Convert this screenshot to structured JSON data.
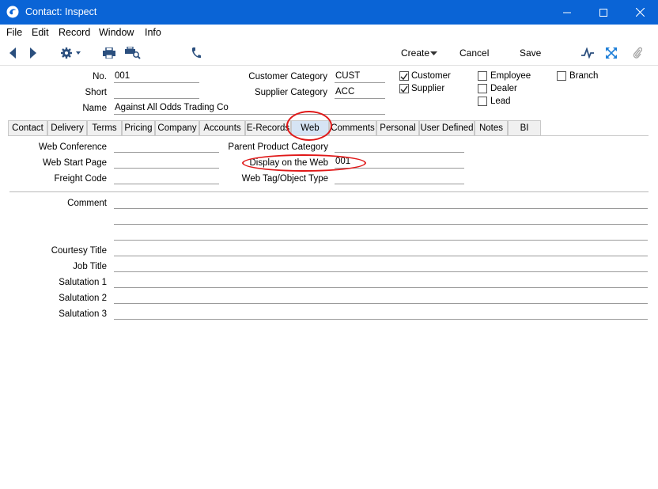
{
  "window": {
    "title": "Contact: Inspect"
  },
  "menu": [
    "File",
    "Edit",
    "Record",
    "Window",
    "Info"
  ],
  "toolbar": {
    "create_label": "Create",
    "cancel_label": "Cancel",
    "save_label": "Save"
  },
  "header": {
    "no_label": "No.",
    "no_value": "001",
    "short_label": "Short",
    "short_value": "",
    "name_label": "Name",
    "name_value": "Against All Odds Trading Co",
    "cust_cat_label": "Customer Category",
    "cust_cat_value": "CUST",
    "supp_cat_label": "Supplier Category",
    "supp_cat_value": "ACC",
    "checkboxes": {
      "customer": {
        "label": "Customer",
        "checked": true
      },
      "supplier": {
        "label": "Supplier",
        "checked": true
      },
      "employee": {
        "label": "Employee",
        "checked": false
      },
      "dealer": {
        "label": "Dealer",
        "checked": false
      },
      "lead": {
        "label": "Lead",
        "checked": false
      },
      "branch": {
        "label": "Branch",
        "checked": false
      }
    }
  },
  "tabs": [
    "Contact",
    "Delivery",
    "Terms",
    "Pricing",
    "Company",
    "Accounts",
    "E-Records",
    "Web",
    "Comments",
    "Personal",
    "User Defined",
    "Notes",
    "BI"
  ],
  "active_tab": "Web",
  "web": {
    "web_conference_label": "Web Conference",
    "web_conference_value": "",
    "web_start_page_label": "Web Start Page",
    "web_start_page_value": "",
    "freight_code_label": "Freight Code",
    "freight_code_value": "",
    "parent_product_category_label": "Parent Product Category",
    "parent_product_category_value": "",
    "display_on_web_label": "Display on the Web",
    "display_on_web_value": "001",
    "web_tag_label": "Web Tag/Object Type",
    "web_tag_value": "",
    "comment_label": "Comment",
    "courtesy_title_label": "Courtesy Title",
    "job_title_label": "Job Title",
    "salutation1_label": "Salutation 1",
    "salutation2_label": "Salutation 2",
    "salutation3_label": "Salutation 3"
  },
  "colors": {
    "titlebar": "#0a64d6",
    "highlight": "#e01818",
    "active_tab": "#d6e4f4"
  }
}
